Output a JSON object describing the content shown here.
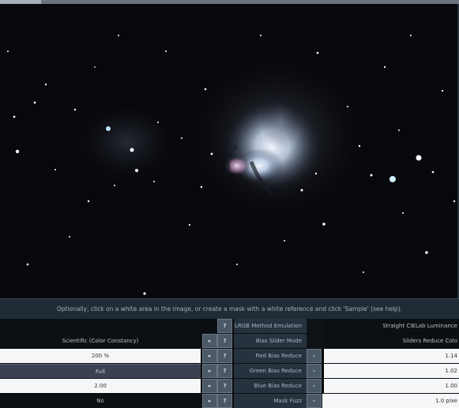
{
  "hint": "Optionally, click on a white area in the image, or create a mask with a white reference and click 'Sample' (see help).",
  "rows": [
    {
      "value": "",
      "label": "LRGB Method Emulation",
      "right": "Straight CIELab Luminance"
    },
    {
      "value": "Scientific (Color Constancy)",
      "label": "Bias Slider Mode",
      "right": "Sliders Reduce Colo"
    },
    {
      "value": "200 %",
      "label": "Red Bias Reduce",
      "right": "1.14"
    },
    {
      "value": "Full",
      "label": "Green Bias Reduce",
      "right": "1.02"
    },
    {
      "value": "2.00",
      "label": "Blue Bias Reduce",
      "right": "1.00"
    },
    {
      "value": "No",
      "label": "Mask Fuzz",
      "right": "1.0 pixe"
    }
  ],
  "buttons": {
    "expand": "▸",
    "help": "?",
    "minus": "-"
  },
  "colors": {
    "nebula_core": "#dfe9f7",
    "nebula_pink": "#c99bc7",
    "panel_bg": "#0a0d11",
    "label_bg": "#26323e"
  }
}
